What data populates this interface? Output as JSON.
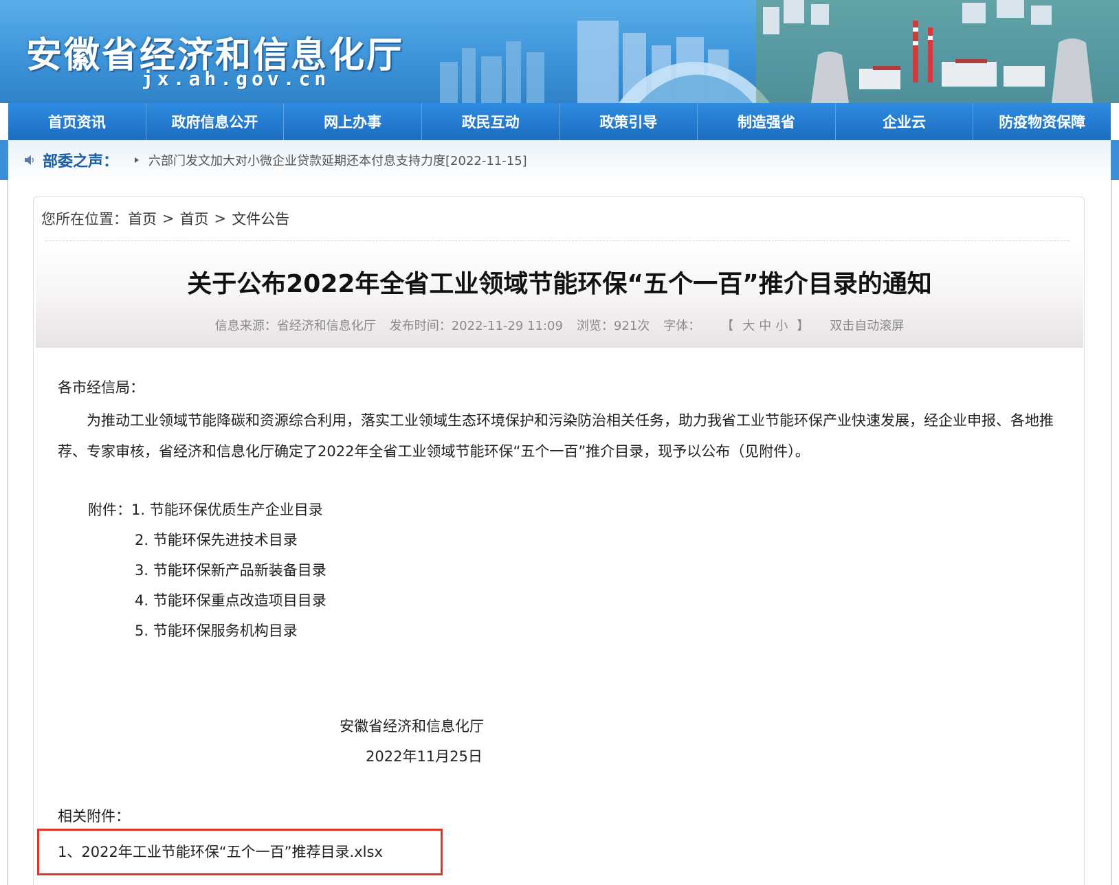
{
  "header": {
    "site_title": "安徽省经济和信息化厅",
    "site_url": "jx.ah.gov.cn"
  },
  "nav": {
    "items": [
      {
        "label": "首页资讯"
      },
      {
        "label": "政府信息公开"
      },
      {
        "label": "网上办事"
      },
      {
        "label": "政民互动"
      },
      {
        "label": "政策引导"
      },
      {
        "label": "制造强省"
      },
      {
        "label": "企业云"
      },
      {
        "label": "防疫物资保障"
      }
    ]
  },
  "ticker": {
    "label": "部委之声：",
    "link_text": "六部门发文加大对小微企业贷款延期还本付息支持力度",
    "link_date": "[2022-11-15]"
  },
  "breadcrumb": {
    "prefix": "您所在位置：",
    "items": [
      "首页",
      "首页",
      "文件公告"
    ],
    "separator": ">"
  },
  "article": {
    "title": "关于公布2022年全省工业领域节能环保“五个一百”推介目录的通知",
    "meta": {
      "source": "信息来源：省经济和信息化厅",
      "published": "发布时间：2022-11-29 11:09",
      "views": "浏览：921次",
      "font_label": "字体：",
      "font_open": "【",
      "font_large": "大",
      "font_medium": "中",
      "font_small": "小",
      "font_close": "】",
      "autoscroll": "双击自动滚屏"
    },
    "salutation": "各市经信局：",
    "paragraph": "为推动工业领域节能降碳和资源综合利用，落实工业领域生态环境保护和污染防治相关任务，助力我省工业节能环保产业快速发展，经企业申报、各地推荐、专家审核，省经济和信息化厅确定了2022年全省工业领域节能环保“五个一百”推介目录，现予以公布（见附件）。",
    "attachments_intro": "附件：1. 节能环保优质生产企业目录",
    "attachments": [
      "2. 节能环保先进技术目录",
      "3. 节能环保新产品新装备目录",
      "4. 节能环保重点改造项目目录",
      "5. 节能环保服务机构目录"
    ],
    "signer": "安徽省经济和信息化厅",
    "date": "2022年11月25日",
    "related_label": "相关附件：",
    "download": "1、2022年工业节能环保“五个一百”推荐目录.xlsx"
  },
  "colors": {
    "nav_bg": "#1b6cc0",
    "ticker_label": "#1a5ea8",
    "highlight_box": "#e0342b"
  }
}
